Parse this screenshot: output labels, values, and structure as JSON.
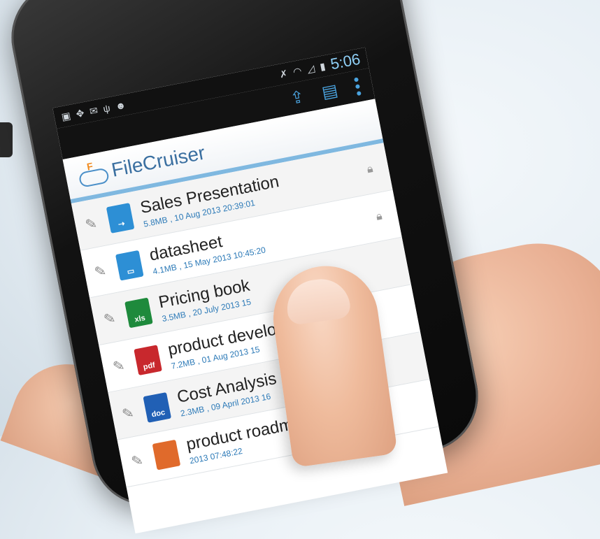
{
  "status_bar": {
    "time": "5:06",
    "icons": [
      "image-icon",
      "dropbox-icon",
      "mail-icon",
      "usb-icon",
      "android-icon"
    ],
    "right_icons": [
      "mute-icon",
      "wifi-icon",
      "signal-icon",
      "battery-icon"
    ]
  },
  "action_bar": {
    "icons": [
      "upload-icon",
      "folder-icon",
      "overflow-menu-icon"
    ]
  },
  "app": {
    "name": "FileCruiser"
  },
  "files": [
    {
      "name": "Sales Presentation",
      "meta": "5.8MB ,  10 Aug 2013  20:39:01",
      "type": "folder-share",
      "color": "#2d8fd5",
      "locked": true
    },
    {
      "name": "datasheet",
      "meta": "4.1MB ,  15 May 2013  10:45:20",
      "type": "folder",
      "color": "#2d8fd5",
      "locked": true
    },
    {
      "name": "Pricing book",
      "meta": "3.5MB ,  20 July 2013  15",
      "type": "xls",
      "color": "#1e8a3c",
      "locked": false
    },
    {
      "name": "product develop",
      "meta": "7.2MB ,  01 Aug 2013  15",
      "type": "pdf",
      "color": "#c8282d",
      "locked": false
    },
    {
      "name": "Cost Analysis",
      "meta": "2.3MB ,  09 April 2013  16",
      "type": "doc",
      "color": "#2160b5",
      "locked": false
    },
    {
      "name": "product roadmap",
      "meta": "2013  07:48:22",
      "type": "ppt",
      "color": "#e06a2b",
      "locked": false
    }
  ],
  "labels": {
    "xls": "xls",
    "pdf": "pdf",
    "doc": "doc"
  }
}
